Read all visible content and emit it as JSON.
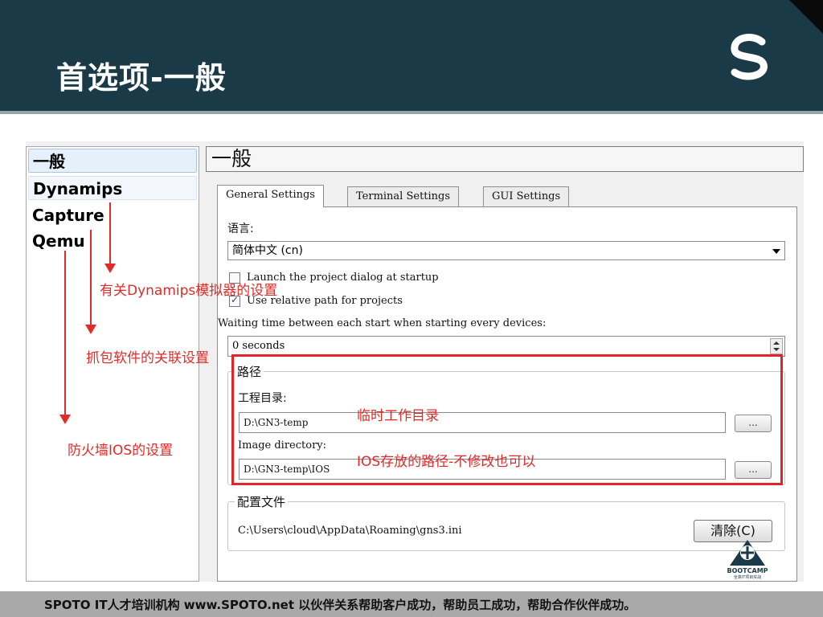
{
  "slide": {
    "title": "首选项-一般",
    "footer": "SPOTO IT人才培训机构   www.SPOTO.net   以伙伴关系帮助客户成功，帮助员工成功，帮助合作伙伴成功。",
    "brand_color": "#1b3a47",
    "logo_icon": "spoto-s-logo-icon"
  },
  "sidebar": {
    "items": [
      {
        "label": "一般",
        "state": "selected"
      },
      {
        "label": "Dynamips",
        "state": "hover"
      },
      {
        "label": "Capture",
        "state": "normal"
      },
      {
        "label": "Qemu",
        "state": "normal"
      }
    ]
  },
  "main": {
    "section_title": "一般",
    "tabs": [
      {
        "label": "General Settings",
        "active": true
      },
      {
        "label": "Terminal Settings",
        "active": false
      },
      {
        "label": "GUI Settings",
        "active": false
      }
    ],
    "language_label": "语言:",
    "language_value": "简体中文 (cn)",
    "launch_dialog_label": "Launch the project dialog at startup",
    "launch_dialog_checked": false,
    "relative_path_label": "Use relative path for projects",
    "relative_path_checked": true,
    "waiting_label": "Waiting time between each start when starting every devices:",
    "waiting_value": "0 seconds",
    "paths_group": {
      "title": "路径",
      "project_dir_label": "工程目录:",
      "project_dir_value": "D:\\GN3-temp",
      "browse_label": "...",
      "image_dir_label": "Image directory:",
      "image_dir_value": "D:\\GN3-temp\\IOS"
    },
    "config_group": {
      "title": "配置文件",
      "path": "C:\\Users\\cloud\\AppData\\Roaming\\gns3.ini",
      "clear_label": "清除(C)"
    }
  },
  "annotations": {
    "dynamips": "有关Dynamips模拟器的设置",
    "capture": "抓包软件的关联设置",
    "qemu": "防火墙IOS的设置",
    "project_dir": "临时工作目录",
    "image_dir": "IOS存放的路径-不修改也可以",
    "color": "#e02b2b"
  },
  "bootcamp": {
    "label": "BOOTCAMP",
    "sublabel": "全真IT项目实战"
  }
}
